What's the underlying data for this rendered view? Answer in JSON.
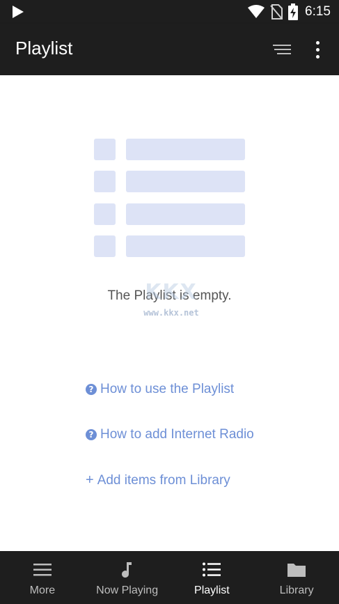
{
  "status_bar": {
    "time": "6:15",
    "icons": [
      "play-icon",
      "wifi-icon",
      "no-sim-icon",
      "battery-charging-icon"
    ]
  },
  "app_bar": {
    "title": "Playlist",
    "actions": [
      "sort-icon",
      "more-vert-icon"
    ]
  },
  "empty_state": {
    "message": "The Playlist is empty.",
    "illustration": "list-placeholder-icon",
    "accent_color": "#dde3f6"
  },
  "watermark": {
    "logo": "KKX",
    "url": "www.kkx.net"
  },
  "links": [
    {
      "icon": "help-circle-icon",
      "label": "How to use the Playlist"
    },
    {
      "icon": "help-circle-icon",
      "label": "How to add Internet Radio"
    },
    {
      "icon": "plus-icon",
      "prefix": "+",
      "label": "Add items from Library"
    }
  ],
  "link_color": "#6d8fd6",
  "bottom_nav": {
    "items": [
      {
        "icon": "menu-icon",
        "label": "More"
      },
      {
        "icon": "music-note-icon",
        "label": "Now Playing"
      },
      {
        "icon": "list-icon",
        "label": "Playlist",
        "active": true
      },
      {
        "icon": "folder-icon",
        "label": "Library"
      }
    ]
  }
}
